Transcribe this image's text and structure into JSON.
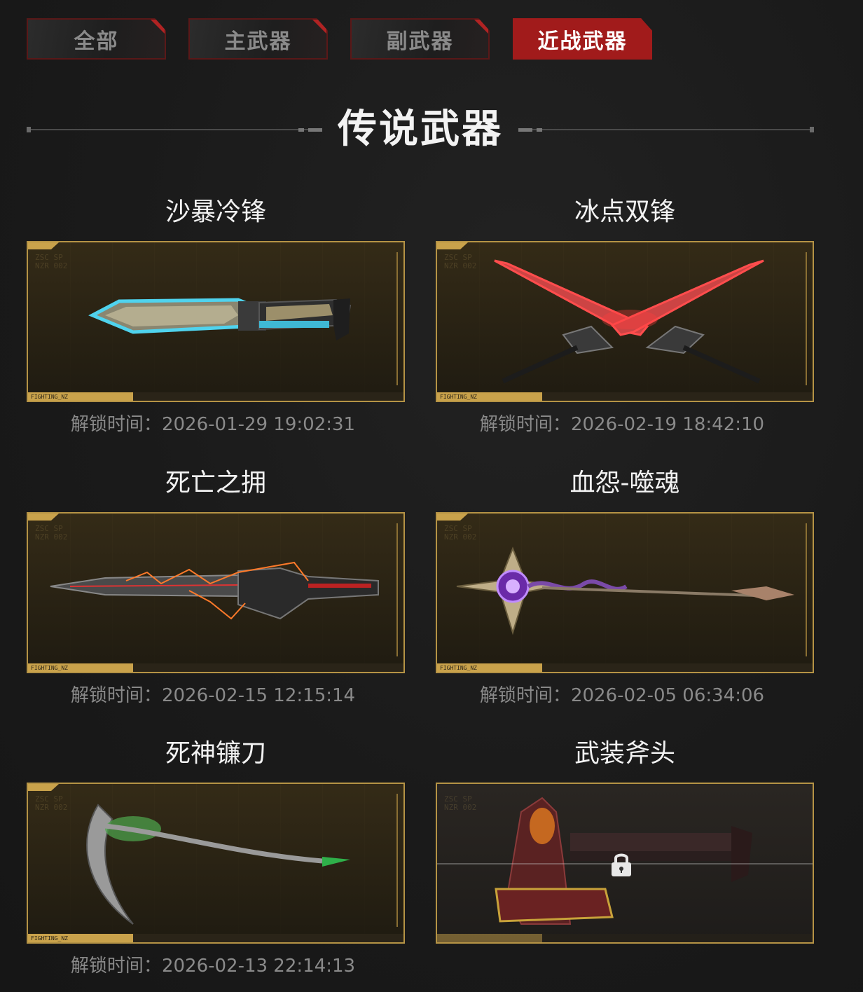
{
  "tabs": [
    {
      "label": "全部",
      "active": false
    },
    {
      "label": "主武器",
      "active": false
    },
    {
      "label": "副武器",
      "active": false
    },
    {
      "label": "近战武器",
      "active": true
    }
  ],
  "section": {
    "title": "传说武器"
  },
  "weapons": [
    {
      "name": "沙暴冷锋",
      "unlock_label": "解锁时间：",
      "unlock_time": "2026-01-29 19:02:31",
      "locked": false,
      "icon": "combat-knife-icon"
    },
    {
      "name": "冰点双锋",
      "unlock_label": "解锁时间：",
      "unlock_time": "2026-02-19 18:42:10",
      "locked": false,
      "icon": "crossed-blades-icon"
    },
    {
      "name": "死亡之拥",
      "unlock_label": "解锁时间：",
      "unlock_time": "2026-02-15 12:15:14",
      "locked": false,
      "icon": "great-sword-icon"
    },
    {
      "name": "血怨-噬魂",
      "unlock_label": "解锁时间：",
      "unlock_time": "2026-02-05 06:34:06",
      "locked": false,
      "icon": "soul-spear-icon"
    },
    {
      "name": "死神镰刀",
      "unlock_label": "解锁时间：",
      "unlock_time": "2026-02-13 22:14:13",
      "locked": false,
      "icon": "scythe-icon"
    },
    {
      "name": "武装斧头",
      "unlock_label": "",
      "unlock_time": "",
      "locked": true,
      "icon": "battle-axe-icon"
    }
  ],
  "card_frame": {
    "corner_code": "FIGHTING_NZ",
    "watermark": "ZSC SP\nNZR 002"
  },
  "colors": {
    "accent_red": "#a11b1b",
    "gold_frame": "#b59345",
    "background": "#1a1a1a"
  }
}
